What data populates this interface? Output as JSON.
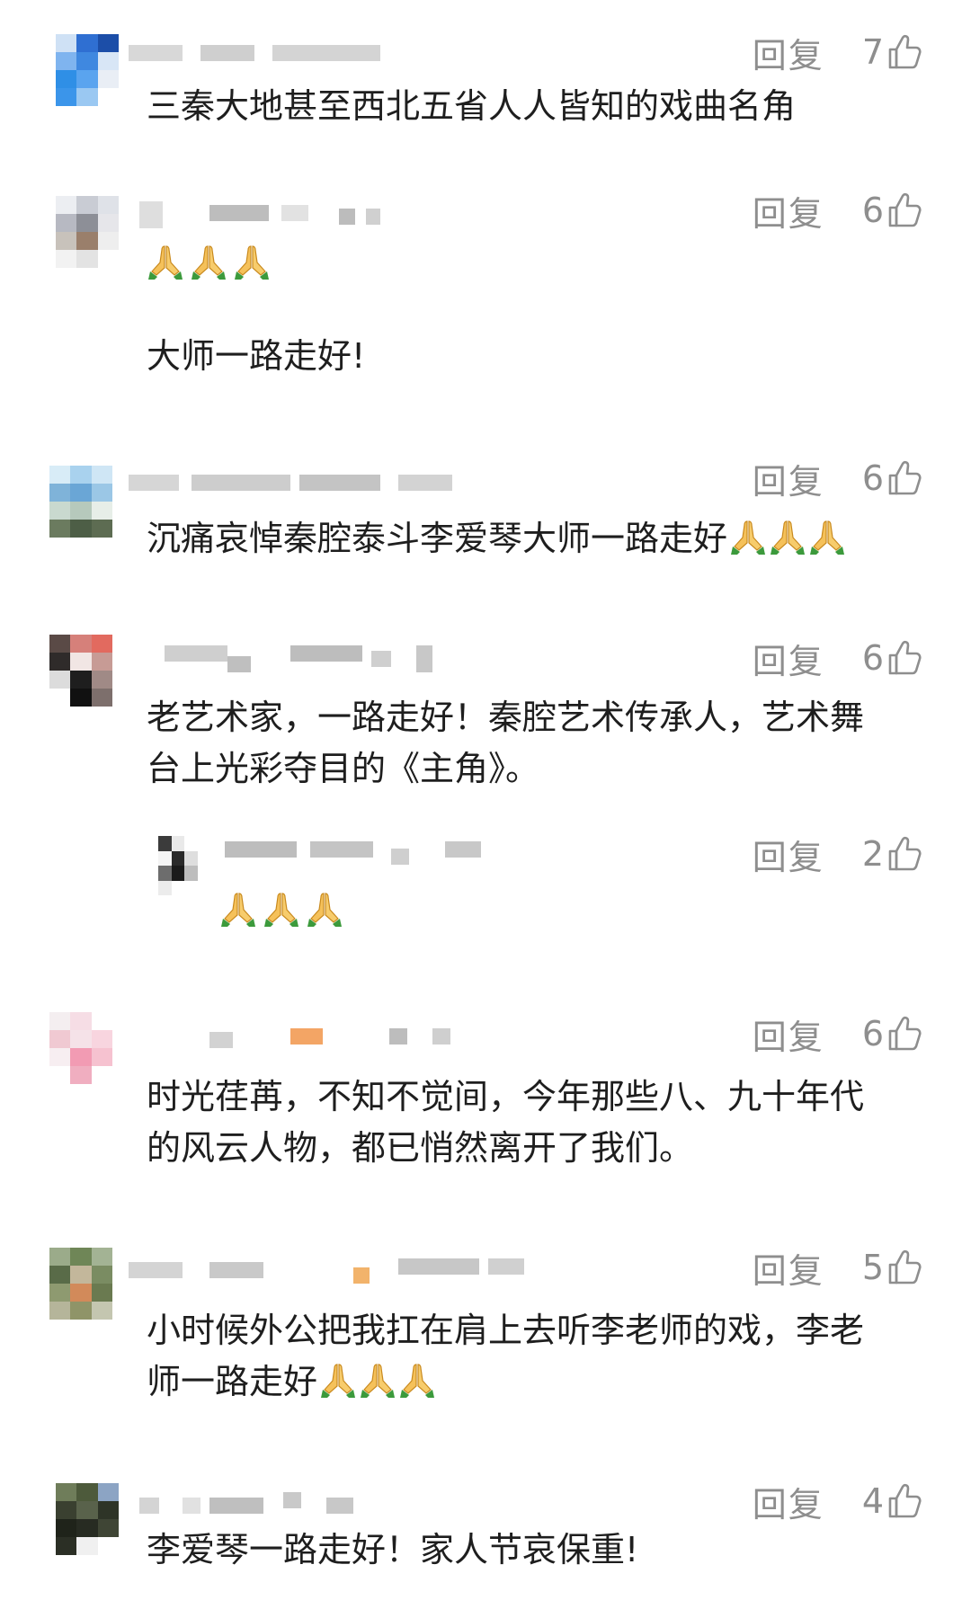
{
  "ui": {
    "reply_label": "回复"
  },
  "comments": [
    {
      "id": "c1",
      "likes": "7",
      "text": "三秦大地甚至西北五省人人皆知的戏曲名角"
    },
    {
      "id": "c2",
      "likes": "6",
      "emoji": [
        "pray-icon",
        "pray-icon",
        "pray-icon"
      ],
      "text": "大师一路走好!"
    },
    {
      "id": "c3",
      "likes": "6",
      "text": "沉痛哀悼秦腔泰斗李爱琴大师一路走好",
      "trailing_emoji": [
        "pray-icon",
        "pray-icon",
        "pray-icon"
      ]
    },
    {
      "id": "c4",
      "likes": "6",
      "text_line1": "老艺术家，一路走好！秦腔艺术传承人，艺术舞",
      "text_line2": "台上光彩夺目的《主角》。"
    },
    {
      "id": "c4-reply",
      "likes": "2",
      "emoji": [
        "pray-icon",
        "pray-icon",
        "pray-icon"
      ]
    },
    {
      "id": "c5",
      "likes": "6",
      "text_line1": "时光荏苒，不知不觉间，今年那些八、九十年代",
      "text_line2": "的风云人物，都已悄然离开了我们。"
    },
    {
      "id": "c6",
      "likes": "5",
      "text_line1": "小时候外公把我扛在肩上去听李老师的戏，李老",
      "text_line2": "师一路走好",
      "trailing_emoji": [
        "pray-icon",
        "pray-icon",
        "pray-icon"
      ]
    },
    {
      "id": "c7",
      "likes": "4",
      "text": "李爱琴一路走好！家人节哀保重!"
    }
  ],
  "colors": {
    "text": "#1e1e1e",
    "meta": "#8e8e8e",
    "background": "#ffffff",
    "pray_skin": "#f5c15a",
    "pray_sleeve": "#3c9a3c"
  }
}
